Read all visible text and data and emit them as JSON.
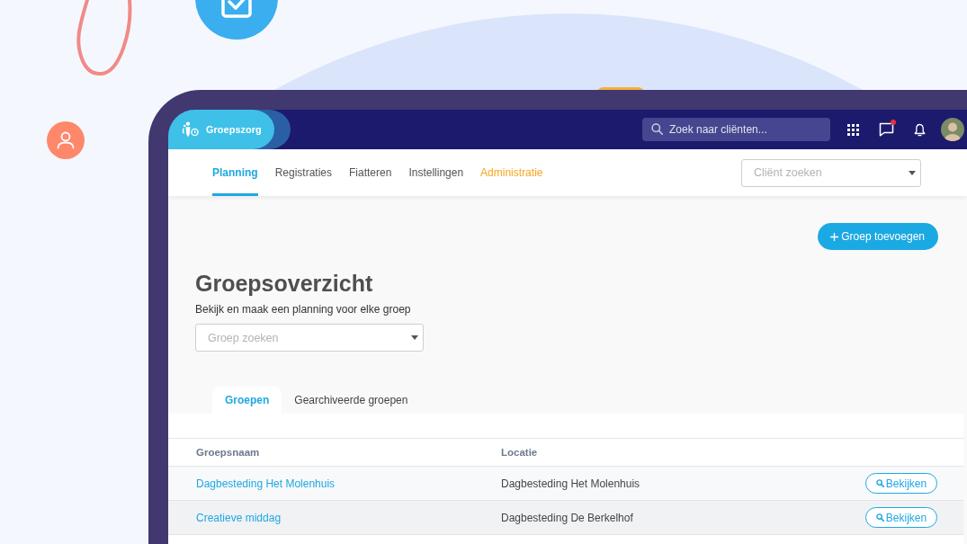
{
  "header": {
    "app_name": "Groepszorg",
    "search": {
      "placeholder": "Zoek naar cliënten..."
    },
    "messages_unread": true
  },
  "nav": {
    "tabs": [
      {
        "label": "Planning",
        "selected": true,
        "highlighted": false
      },
      {
        "label": "Registraties",
        "selected": false,
        "highlighted": false
      },
      {
        "label": "Fiatteren",
        "selected": false,
        "highlighted": false
      },
      {
        "label": "Instellingen",
        "selected": false,
        "highlighted": false
      },
      {
        "label": "Administratie",
        "selected": false,
        "highlighted": true
      }
    ],
    "client_search": {
      "placeholder": "Cliënt zoeken"
    }
  },
  "page": {
    "add_button": "Groep toevoegen",
    "title": "Groepsoverzicht",
    "subtitle": "Bekijk en maak een planning voor elke groep",
    "group_search": {
      "placeholder": "Groep zoeken"
    }
  },
  "group_tabs": [
    {
      "label": "Groepen",
      "selected": true
    },
    {
      "label": "Gearchiveerde groepen",
      "selected": false
    }
  ],
  "table": {
    "columns": [
      "Groepsnaam",
      "Locatie"
    ],
    "rows": [
      {
        "name": "Dagbesteding Het Molenhuis",
        "location": "Dagbesteding Het Molenhuis",
        "action": "Bekijken"
      },
      {
        "name": "Creatieve middag",
        "location": "Dagbesteding De Berkelhof",
        "action": "Bekijken"
      }
    ]
  }
}
